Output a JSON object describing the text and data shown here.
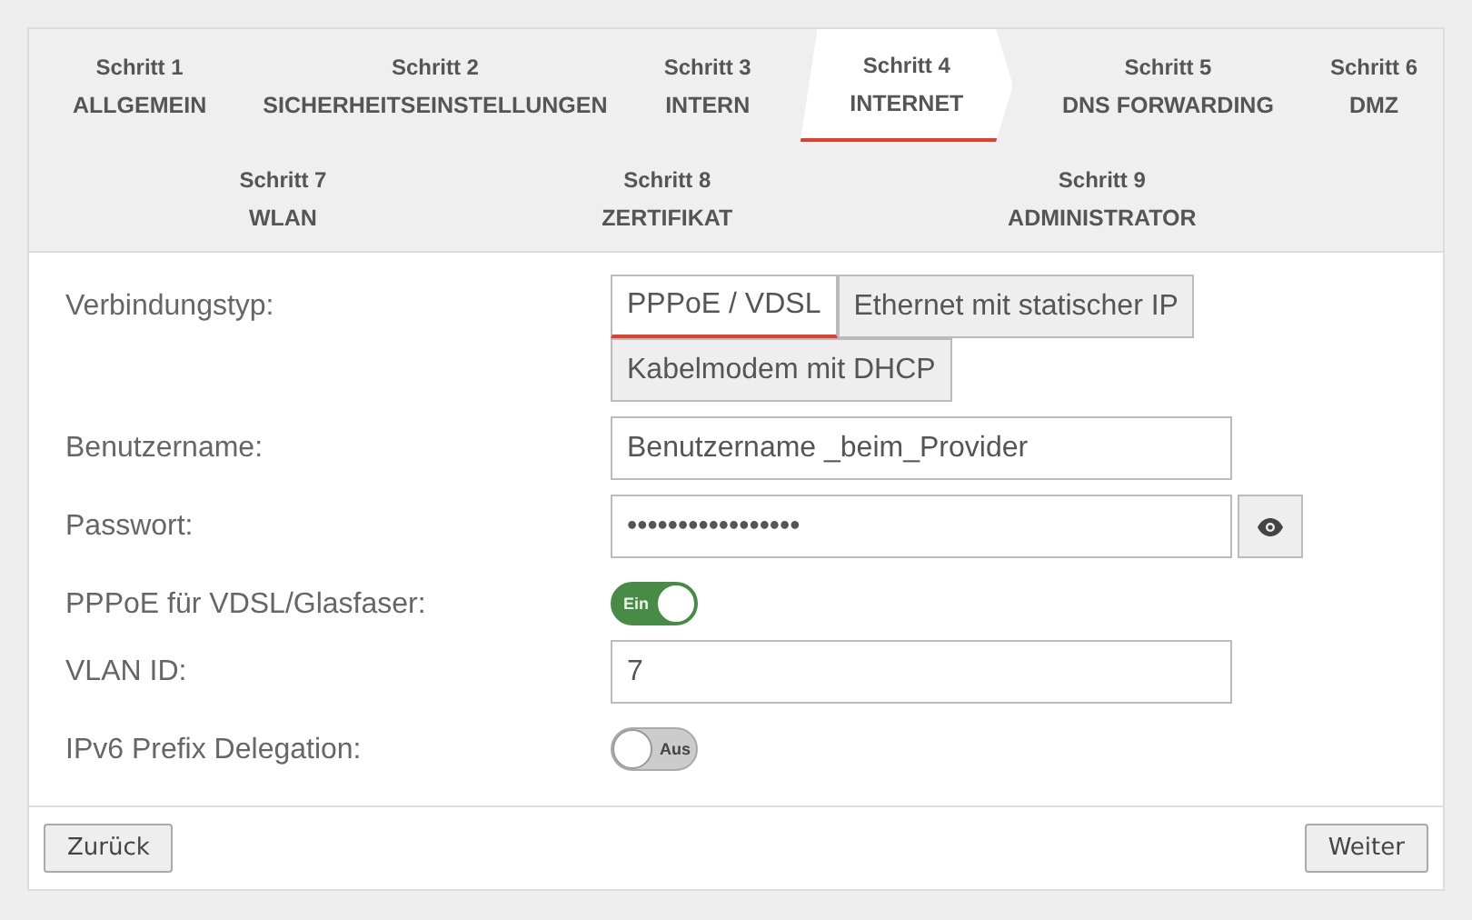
{
  "steps_rows": [
    {
      "steps": [
        {
          "number": "Schritt 1",
          "name": "ALLGEMEIN",
          "selected": false
        },
        {
          "number": "Schritt 2",
          "name": "SICHERHEITSEINSTELLUNGEN",
          "selected": false
        },
        {
          "number": "Schritt 3",
          "name": "INTERN",
          "selected": false
        },
        {
          "number": "Schritt 4",
          "name": "INTERNET",
          "selected": true
        },
        {
          "number": "Schritt 5",
          "name": "DNS FORWARDING",
          "selected": false
        },
        {
          "number": "Schritt 6",
          "name": "DMZ",
          "selected": false
        }
      ]
    },
    {
      "steps": [
        {
          "number": "Schritt 7",
          "name": "WLAN",
          "selected": false
        },
        {
          "number": "Schritt 8",
          "name": "ZERTIFIKAT",
          "selected": false
        },
        {
          "number": "Schritt 9",
          "name": "ADMINISTRATOR",
          "selected": false
        }
      ]
    }
  ],
  "fields": [
    {
      "kind": "segmented",
      "label": "Verbindungstyp:",
      "options": [
        {
          "label": "PPPoE / VDSL",
          "selected": true
        },
        {
          "label": "Ethernet mit statischer IP",
          "selected": false
        },
        {
          "label": "Kabelmodem mit DHCP",
          "selected": false
        }
      ]
    },
    {
      "kind": "text",
      "label": "Benutzername:",
      "value": "Benutzername _beim_Provider"
    },
    {
      "kind": "password",
      "label": "Passwort:",
      "value": "•••••••••••••••••"
    },
    {
      "kind": "toggle",
      "label": "PPPoE für VDSL/Glasfaser:",
      "on": true,
      "state_text": "Ein"
    },
    {
      "kind": "text",
      "label": "VLAN ID:",
      "value": "7"
    },
    {
      "kind": "toggle",
      "label": "IPv6 Prefix Delegation:",
      "on": false,
      "state_text": "Aus"
    }
  ],
  "buttons": {
    "back": "Zurück",
    "next": "Weiter"
  }
}
